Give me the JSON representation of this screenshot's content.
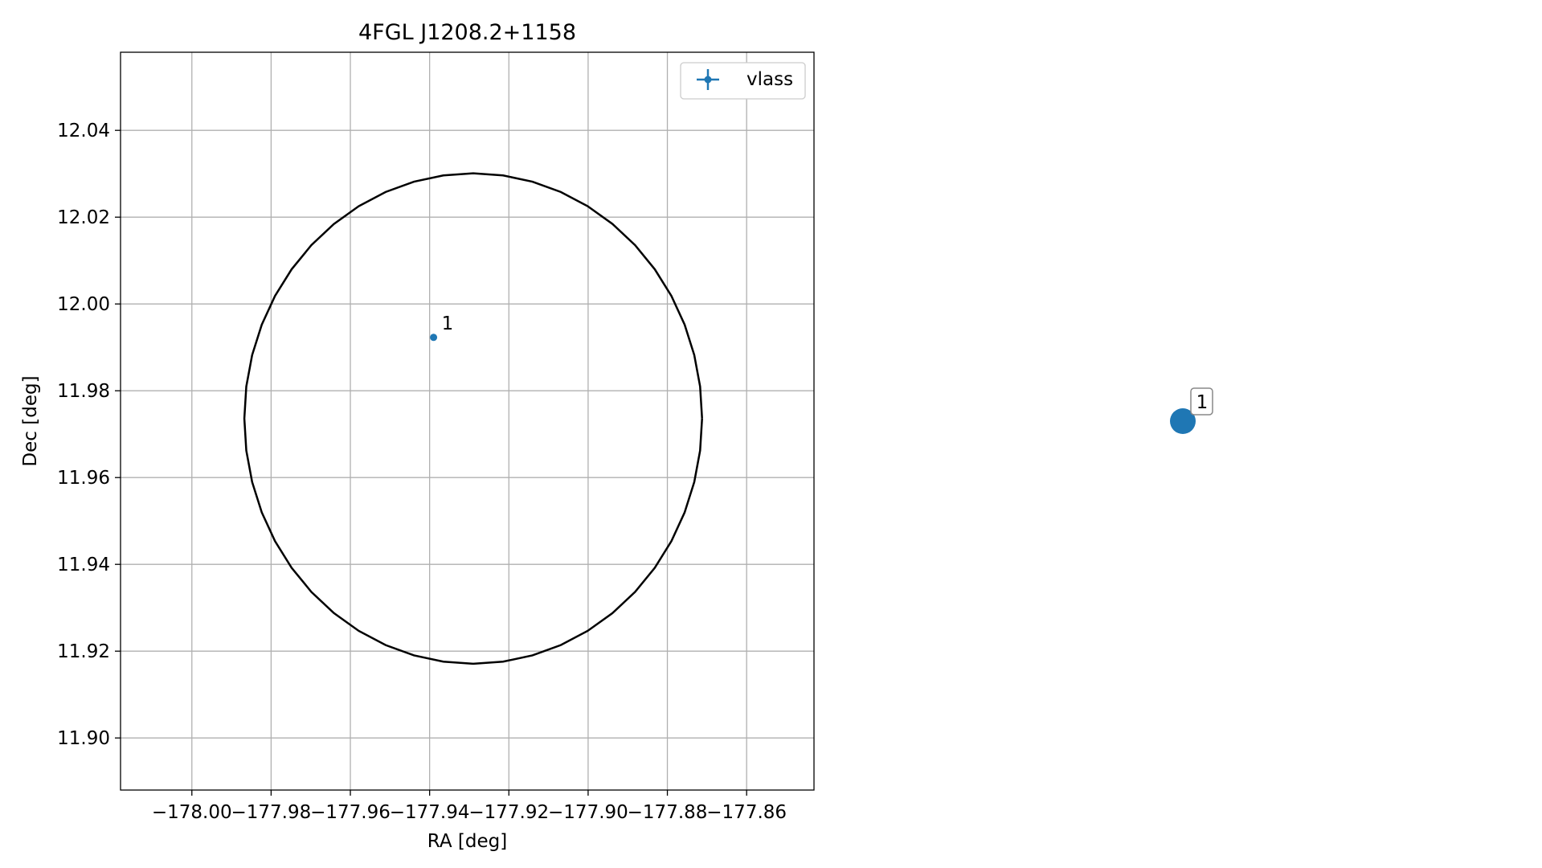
{
  "chart_data": [
    {
      "type": "scatter",
      "title": "4FGL J1208.2+1158",
      "xlabel": "RA [deg]",
      "ylabel": "Dec [deg]",
      "xlim": [
        -178.018,
        -177.843
      ],
      "ylim": [
        11.888,
        12.058
      ],
      "x_ticks": [
        -178.0,
        -177.98,
        -177.96,
        -177.94,
        -177.92,
        -177.9,
        -177.88,
        -177.86
      ],
      "x_tick_labels": [
        "−178.00",
        "−177.98",
        "−177.96",
        "−177.94",
        "−177.92",
        "−177.90",
        "−177.88",
        "−177.86"
      ],
      "y_ticks": [
        11.9,
        11.92,
        11.94,
        11.96,
        11.98,
        12.0,
        12.02,
        12.04
      ],
      "y_tick_labels": [
        "11.90",
        "11.92",
        "11.94",
        "11.96",
        "11.98",
        "12.00",
        "12.02",
        "12.04"
      ],
      "grid": true,
      "legend": {
        "position": "top-right",
        "entries": [
          "vlass"
        ]
      },
      "series": [
        {
          "name": "vlass",
          "color": "#1f77b4",
          "points": [
            {
              "x": -177.939,
              "y": 11.9923,
              "label": "1"
            }
          ]
        }
      ],
      "circle": {
        "center_x": -177.929,
        "center_y": 11.9736,
        "radius_deg": 0.0565,
        "color": "#000000"
      }
    },
    {
      "type": "scatter",
      "axes_visible": false,
      "series": [
        {
          "color": "#1f77b4",
          "points": [
            {
              "label": "1"
            }
          ]
        }
      ]
    }
  ]
}
